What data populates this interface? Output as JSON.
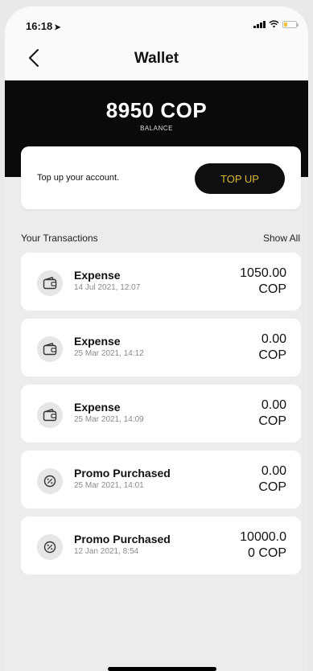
{
  "status_bar": {
    "time": "16:18"
  },
  "header": {
    "title": "Wallet"
  },
  "balance": {
    "amount": "8950 COP",
    "label": "BALANCE"
  },
  "topup": {
    "text": "Top up your account.",
    "button_label": "TOP UP"
  },
  "transactions_section": {
    "title": "Your Transactions",
    "show_all": "Show All"
  },
  "transactions": [
    {
      "icon": "wallet-icon",
      "name": "Expense",
      "date": "14 Jul 2021, 12:07",
      "amount_line1": "1050.00",
      "amount_line2": "COP"
    },
    {
      "icon": "wallet-icon",
      "name": "Expense",
      "date": "25 Mar 2021, 14:12",
      "amount_line1": "0.00",
      "amount_line2": "COP"
    },
    {
      "icon": "wallet-icon",
      "name": "Expense",
      "date": "25 Mar 2021, 14:09",
      "amount_line1": "0.00",
      "amount_line2": "COP"
    },
    {
      "icon": "promo-icon",
      "name": "Promo Purchased",
      "date": "25 Mar 2021, 14:01",
      "amount_line1": "0.00",
      "amount_line2": "COP"
    },
    {
      "icon": "promo-icon",
      "name": "Promo Purchased",
      "date": "12 Jan 2021, 8:54",
      "amount_line1": "10000.0",
      "amount_line2": "0 COP"
    }
  ],
  "colors": {
    "accent_gold": "#d8b733",
    "balance_bg": "#0a0a0a",
    "page_bg": "#ececec",
    "battery": "#f2c230"
  }
}
